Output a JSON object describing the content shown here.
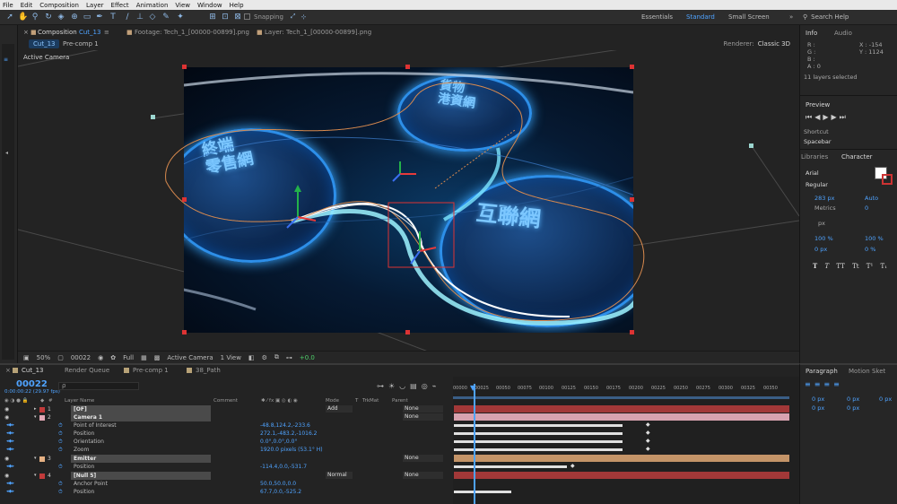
{
  "menu": [
    "File",
    "Edit",
    "Composition",
    "Layer",
    "Effect",
    "Animation",
    "View",
    "Window",
    "Help"
  ],
  "toolbar": {
    "snapping_label": "Snapping",
    "workspaces": [
      "Essentials",
      "Standard",
      "Small Screen"
    ],
    "active_workspace": "Standard",
    "search_label": "Search Help"
  },
  "comp_tabs": {
    "comp_prefix": "Composition",
    "comp_name": "Cut_13",
    "footage_tab": "Footage: Tech_1_[00000-00899].png",
    "layer_tab": "Layer: Tech_1_[00000-00899].png"
  },
  "comp_subrow": {
    "chip": "Cut_13",
    "crumb": "Pre-comp 1",
    "renderer_label": "Renderer:",
    "renderer_value": "Classic 3D"
  },
  "viewer": {
    "camera_label": "Active Camera",
    "disk_texts": [
      "終端\n零售網",
      "貨物\n港資網",
      "互聯網"
    ]
  },
  "viewer_footer": {
    "zoom": "50%",
    "frame": "00022",
    "resolution": "Full",
    "view": "Active Camera",
    "views": "1 View",
    "exposure": "+0.0"
  },
  "info": {
    "tabs": [
      "Info",
      "Audio"
    ],
    "rgba": [
      "R :",
      "G :",
      "B :",
      "A : 0"
    ],
    "x": "X : -154",
    "y": "Y : 1124",
    "status": "11 layers selected"
  },
  "preview": {
    "title": "Preview",
    "shortcut_label": "Shortcut",
    "shortcut_value": "Spacebar"
  },
  "character": {
    "tabs": [
      "Libraries",
      "Character"
    ],
    "font": "Arial",
    "style": "Regular",
    "size": "283 px",
    "leading": "Auto",
    "kerning": "Metrics",
    "tracking": "0",
    "stroke": "px",
    "vscale": "100 %",
    "hscale": "100 %",
    "baseline": "0 px",
    "tsume": "0 %",
    "styles": [
      "T",
      "T",
      "TT",
      "Tt",
      "T¹",
      "T₁"
    ]
  },
  "timeline": {
    "tabs": [
      "Cut_13",
      "Render Queue",
      "Pre-comp 1",
      "38_Path"
    ],
    "timecode": "00022",
    "timecode_sub": "0:00:00:22 (29.97 fps)",
    "search_placeholder": "ρ",
    "headers": {
      "name": "Layer Name",
      "comment": "Comment",
      "mode": "Mode",
      "t": "T",
      "trkmat": "TrkMat",
      "parent": "Parent"
    },
    "ruler": [
      "00000",
      "00025",
      "00050",
      "00075",
      "00100",
      "00125",
      "00150",
      "00175",
      "00200",
      "00225",
      "00250",
      "00275",
      "00300",
      "00325",
      "00350"
    ],
    "layers": [
      {
        "num": "1",
        "name": "[OF]",
        "mode": "Add",
        "parent": "None",
        "color": "#c23b3b"
      },
      {
        "num": "2",
        "name": "Camera 1",
        "mode": "",
        "parent": "None",
        "color": "#e3a8b6"
      },
      {
        "num": "3",
        "name": "Emitter",
        "mode": "",
        "parent": "None",
        "color": "#e6b183"
      },
      {
        "num": "4",
        "name": "[Null 5]",
        "mode": "Normal",
        "parent": "None",
        "color": "#c23b3b"
      }
    ],
    "props": [
      {
        "name": "Point of Interest",
        "value": "-48.8,124.2,-233.6"
      },
      {
        "name": "Position",
        "value": "272.1,-483.2,-1016.2"
      },
      {
        "name": "Orientation",
        "value": "0.0°,0.0°,0.0°"
      },
      {
        "name": "Zoom",
        "value": "1920.0 pixels (53.1° H)"
      },
      {
        "name": "Position",
        "value": "-114.4,0.0,-531.7"
      },
      {
        "name": "Anchor Point",
        "value": "50.0,50.0,0.0"
      },
      {
        "name": "Position",
        "value": "67.7,0.0,-525.2"
      }
    ]
  },
  "paragraph": {
    "tabs": [
      "Paragraph",
      "Motion Sket"
    ],
    "values": [
      "0 px",
      "0 px",
      "0 px",
      "0 px",
      "0 px"
    ]
  },
  "colors": {
    "accent": "#4fa3ff",
    "panel": "#232323",
    "menubar": "#e9e9e9"
  }
}
